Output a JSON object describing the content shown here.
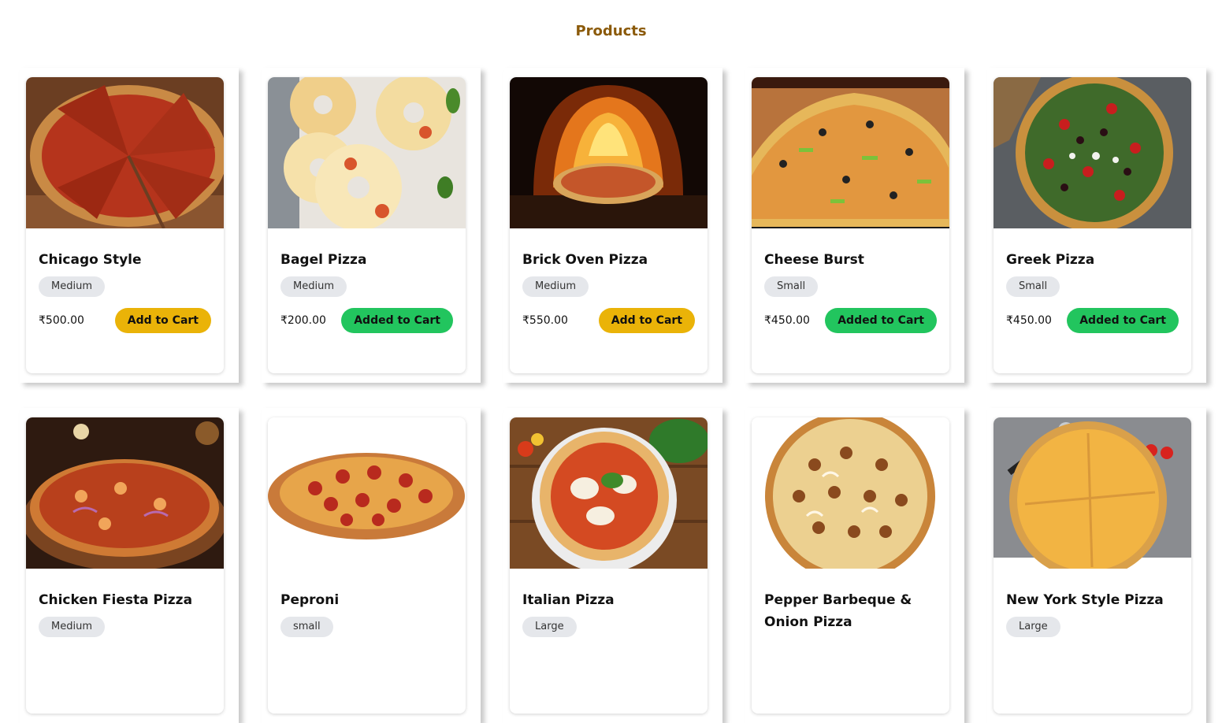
{
  "page": {
    "title": "Products"
  },
  "colors": {
    "title": "#8b5a0a",
    "add_button": "#eab308",
    "added_button": "#22c55e",
    "badge": "#e5e7eb"
  },
  "products": [
    {
      "name": "Chicago Style",
      "size": "Medium",
      "price": "₹500.00",
      "button": "Add to Cart"
    },
    {
      "name": "Bagel Pizza",
      "size": "Medium",
      "price": "₹200.00",
      "button": "Added to Cart"
    },
    {
      "name": "Brick Oven Pizza",
      "size": "Medium",
      "price": "₹550.00",
      "button": "Add to Cart"
    },
    {
      "name": "Cheese Burst",
      "size": "Small",
      "price": "₹450.00",
      "button": "Added to Cart"
    },
    {
      "name": "Greek Pizza",
      "size": "Small",
      "price": "₹450.00",
      "button": "Added to Cart"
    },
    {
      "name": "Chicken Fiesta Pizza",
      "size": "Medium",
      "price": "",
      "button": ""
    },
    {
      "name": "Peproni",
      "size": "small",
      "price": "",
      "button": ""
    },
    {
      "name": "Italian Pizza",
      "size": "Large",
      "price": "",
      "button": ""
    },
    {
      "name": "Pepper Barbeque & Onion Pizza",
      "size": "",
      "price": "",
      "button": ""
    },
    {
      "name": "New York Style Pizza",
      "size": "Large",
      "price": "",
      "button": ""
    }
  ]
}
